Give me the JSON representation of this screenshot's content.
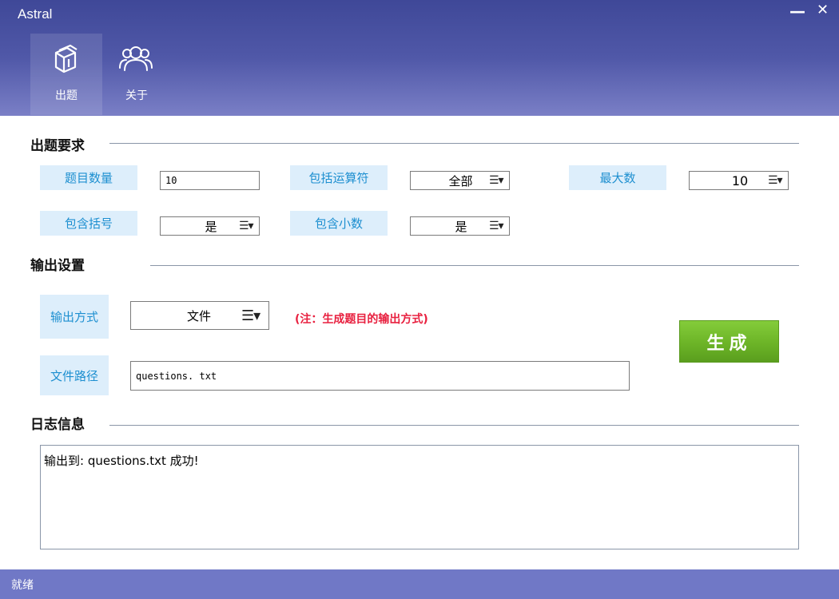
{
  "window": {
    "title": "Astral",
    "minimize_glyph": "—",
    "close_glyph": "✕"
  },
  "nav": {
    "items": [
      {
        "label": "出题",
        "icon": "cards-icon",
        "active": true
      },
      {
        "label": "关于",
        "icon": "users-icon",
        "active": false
      }
    ]
  },
  "requirements": {
    "title": "出题要求",
    "question_count": {
      "label": "题目数量",
      "value": "10"
    },
    "operators": {
      "label": "包括运算符",
      "value": "全部"
    },
    "max_number": {
      "label": "最大数",
      "value": "10"
    },
    "brackets": {
      "label": "包含括号",
      "value": "是"
    },
    "decimals": {
      "label": "包含小数",
      "value": "是"
    }
  },
  "output": {
    "title": "输出设置",
    "mode": {
      "label": "输出方式",
      "value": "文件"
    },
    "note": "(注：生成题目的输出方式)",
    "path": {
      "label": "文件路径",
      "value": "questions. txt"
    },
    "generate_label": "生成"
  },
  "log": {
    "title": "日志信息",
    "text": "输出到: questions.txt 成功!"
  },
  "status": {
    "text": "就绪"
  },
  "colors": {
    "header_top": "#3f4898",
    "header_bottom": "#7a7fc6",
    "label_bg": "#ddeefb",
    "label_text": "#1d8fd0",
    "note": "#e8203f",
    "generate": "#6cb427",
    "status_bar": "#7078c6"
  }
}
